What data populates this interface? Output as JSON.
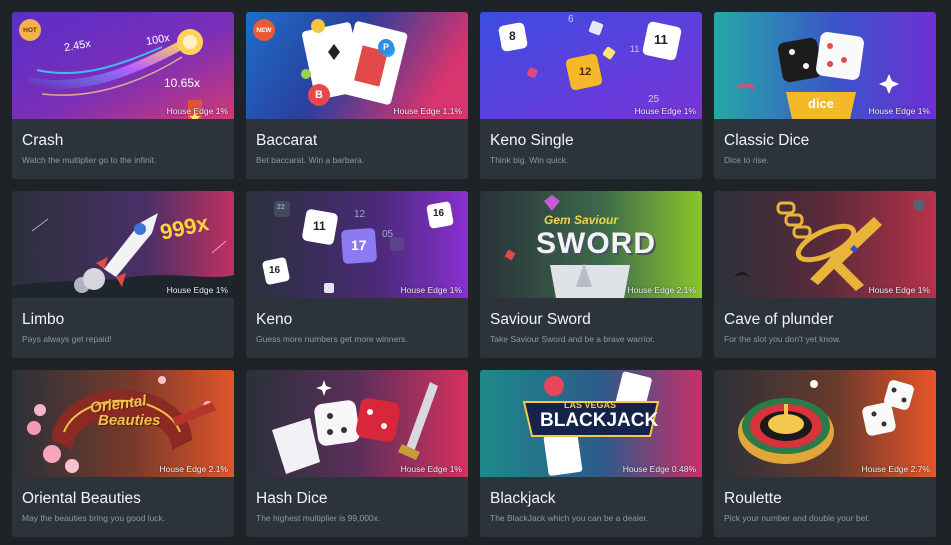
{
  "games": [
    {
      "id": "crash",
      "title": "Crash",
      "desc": "Watch the multiplier go to the infinit.",
      "edge": "House Edge 1%",
      "badge": "HOT",
      "art_text": [
        "2.45x",
        "100x",
        "10.65x"
      ]
    },
    {
      "id": "baccarat",
      "title": "Baccarat",
      "desc": "Bet baccarat. Win a barbara.",
      "edge": "House Edge 1.1%",
      "badge": "NEW",
      "art_text": [
        "B",
        "P"
      ]
    },
    {
      "id": "keno-single",
      "title": "Keno Single",
      "desc": "Think big. Win quick.",
      "edge": "House Edge 1%",
      "art_text": [
        "8",
        "6",
        "12",
        "11",
        "11",
        "25"
      ]
    },
    {
      "id": "classic-dice",
      "title": "Classic Dice",
      "desc": "Dice to rise.",
      "edge": "House Edge 1%",
      "art_text": [
        "dice"
      ]
    },
    {
      "id": "limbo",
      "title": "Limbo",
      "desc": "Pays always get repaid!",
      "edge": "House Edge 1%",
      "art_text": [
        "999x"
      ]
    },
    {
      "id": "keno",
      "title": "Keno",
      "desc": "Guess more numbers get more winners.",
      "edge": "House Edge 1%",
      "art_text": [
        "11",
        "17",
        "16",
        "16",
        "12",
        "05",
        "22"
      ]
    },
    {
      "id": "saviour-sword",
      "title": "Saviour Sword",
      "desc": "Take Saviour Sword and be a brave warrior.",
      "edge": "House Edge 2.1%",
      "art_text": [
        "Gem Saviour",
        "SWORD"
      ]
    },
    {
      "id": "cave-of-plunder",
      "title": "Cave of plunder",
      "desc": "For the slot you don't yet know.",
      "edge": "House Edge 1%"
    },
    {
      "id": "oriental-beauties",
      "title": "Oriental Beauties",
      "desc": "May the beauties bring you good luck.",
      "edge": "House Edge 2.1%",
      "art_text": [
        "Oriental",
        "Beauties"
      ]
    },
    {
      "id": "hash-dice",
      "title": "Hash Dice",
      "desc": "The highest multiplier is 99,000x.",
      "edge": "House Edge 1%"
    },
    {
      "id": "blackjack",
      "title": "Blackjack",
      "desc": "The BlackJack which you can be a dealer.",
      "edge": "House Edge 0.48%",
      "art_text": [
        "LAS VEGAS",
        "BLACKJACK"
      ]
    },
    {
      "id": "roulette",
      "title": "Roulette",
      "desc": "Pick your number and double your bet.",
      "edge": "House Edge 2.7%"
    }
  ]
}
